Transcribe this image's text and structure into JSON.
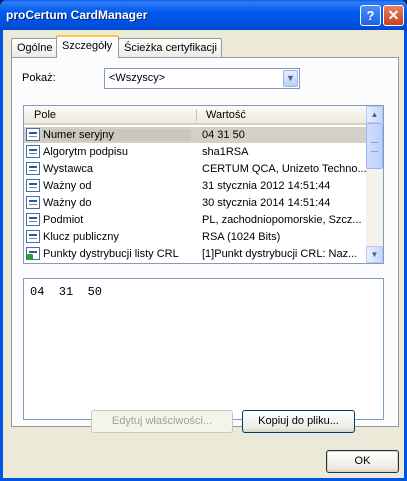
{
  "window": {
    "title": "proCertum CardManager",
    "help_glyph": "?",
    "close_glyph": "✕"
  },
  "tabs": [
    {
      "label": "Ogólne"
    },
    {
      "label": "Szczegóły"
    },
    {
      "label": "Ścieżka certyfikacji"
    }
  ],
  "show": {
    "label": "Pokaż:",
    "value": "<Wszyscy>",
    "arrow": "▼"
  },
  "table": {
    "columns": [
      "Pole",
      "Wartość"
    ],
    "rows": [
      {
        "field": "Numer seryjny",
        "value": "04 31 50",
        "icon": "field-icon"
      },
      {
        "field": "Algorytm podpisu",
        "value": "sha1RSA",
        "icon": "field-icon"
      },
      {
        "field": "Wystawca",
        "value": "CERTUM QCA, Unizeto Techno...",
        "icon": "field-icon"
      },
      {
        "field": "Ważny od",
        "value": "31 stycznia 2012 14:51:44",
        "icon": "field-icon"
      },
      {
        "field": "Ważny do",
        "value": "30 stycznia 2014 14:51:44",
        "icon": "field-icon"
      },
      {
        "field": "Podmiot",
        "value": "PL, zachodniopomorskie, Szcz...",
        "icon": "field-icon"
      },
      {
        "field": "Klucz publiczny",
        "value": "RSA (1024 Bits)",
        "icon": "field-icon"
      },
      {
        "field": "Punkty dystrybucji listy CRL",
        "value": "[1]Punkt dystrybucji CRL: Naz...",
        "icon": "extension-icon"
      }
    ],
    "selected_index": 0,
    "scroll_up": "▲",
    "scroll_down": "▼"
  },
  "detail": {
    "text": "04  31  50"
  },
  "buttons": {
    "edit_properties": "Edytuj właściwości...",
    "copy_to_file": "Kopiuj do pliku...",
    "ok": "OK"
  }
}
